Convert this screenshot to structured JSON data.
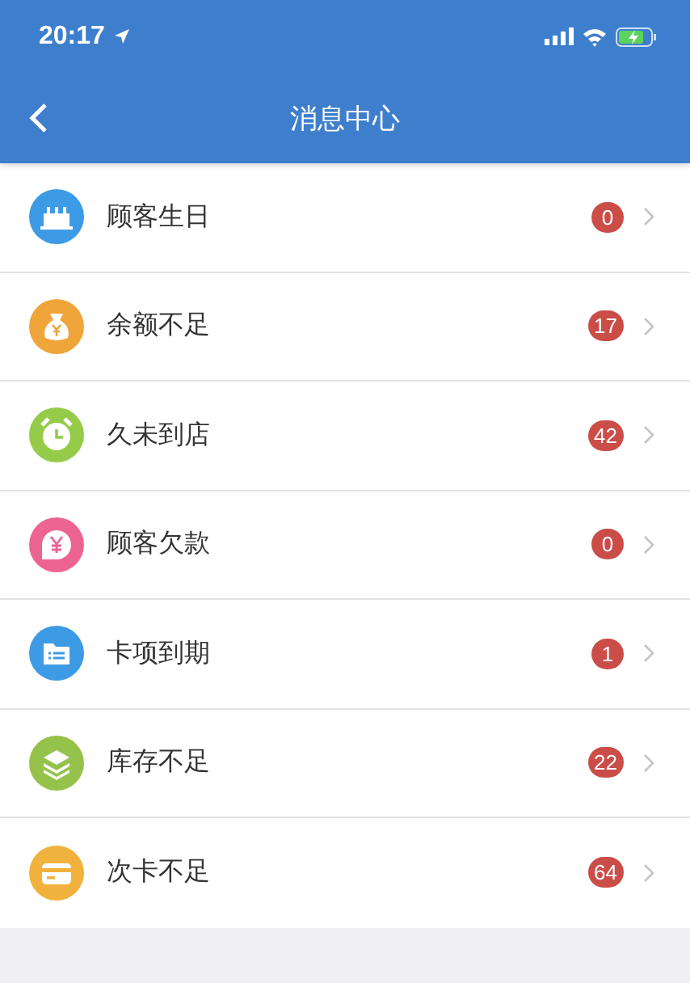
{
  "status_bar": {
    "time": "20:17"
  },
  "nav": {
    "title": "消息中心"
  },
  "items": [
    {
      "label": "顾客生日",
      "count": "0",
      "kind": "cake",
      "color": "#3d9be5"
    },
    {
      "label": "余额不足",
      "count": "17",
      "kind": "moneybag",
      "color": "#f0a53a"
    },
    {
      "label": "久未到店",
      "count": "42",
      "kind": "clock",
      "color": "#95cb48"
    },
    {
      "label": "顾客欠款",
      "count": "0",
      "kind": "yen",
      "color": "#ec6492"
    },
    {
      "label": "卡项到期",
      "count": "1",
      "kind": "list",
      "color": "#3d9be5"
    },
    {
      "label": "库存不足",
      "count": "22",
      "kind": "layers",
      "color": "#95c24a"
    },
    {
      "label": "次卡不足",
      "count": "64",
      "kind": "card",
      "color": "#f0b23c"
    }
  ]
}
